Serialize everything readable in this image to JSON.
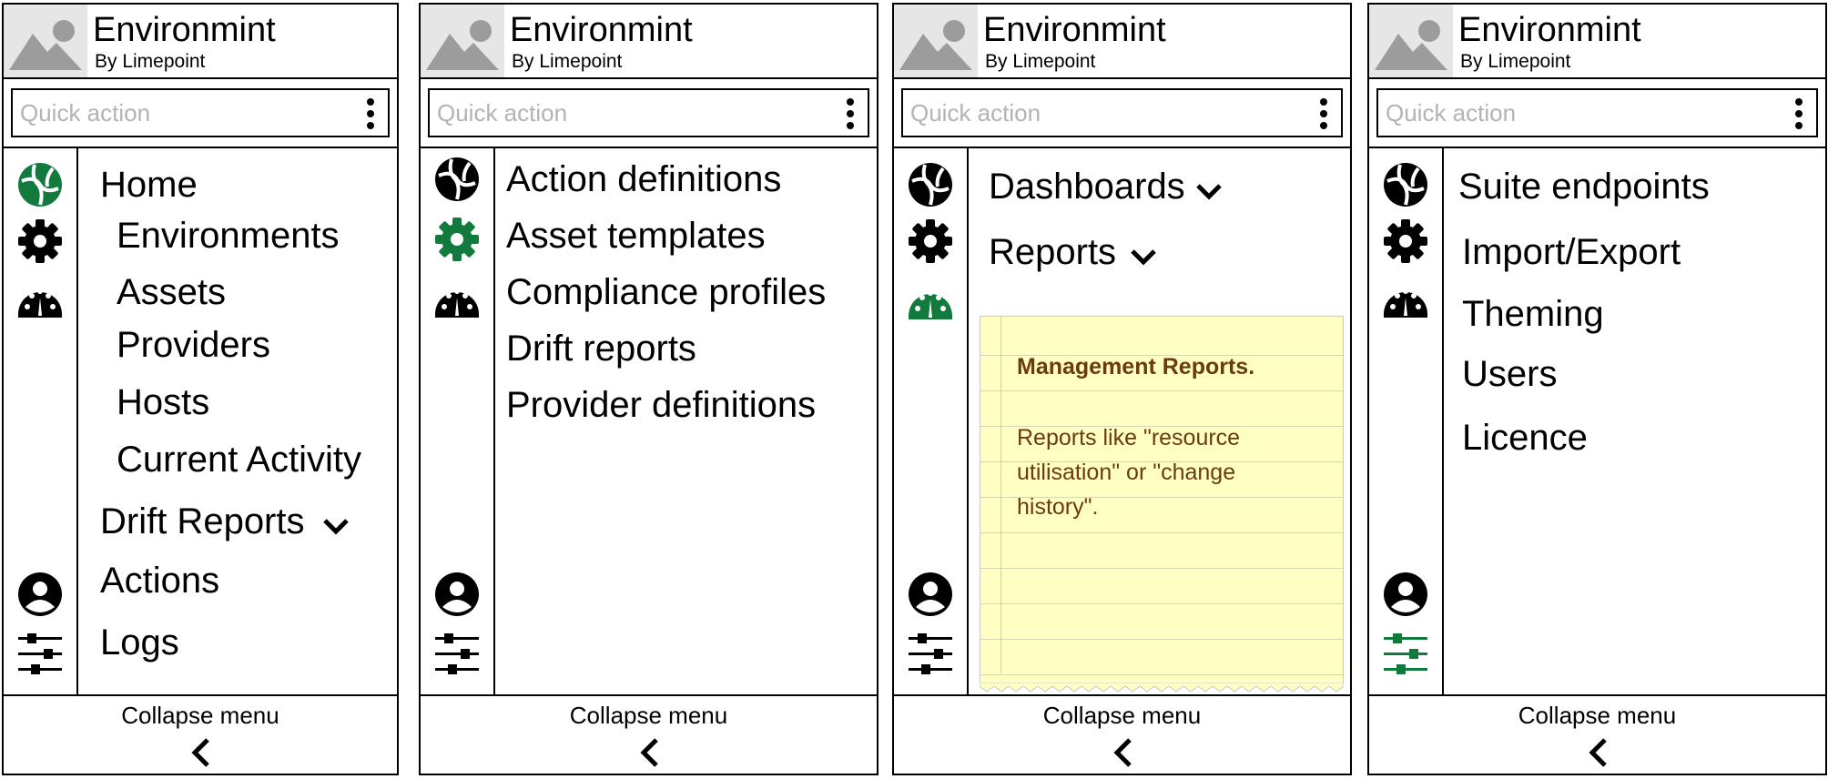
{
  "app": {
    "title": "Environmint",
    "subtitle": "By Limepoint"
  },
  "quick_action": {
    "placeholder": "Quick action"
  },
  "footer": {
    "label": "Collapse menu"
  },
  "colors": {
    "accent": "#117a3c",
    "note_bg": "#ffffc4",
    "note_text": "#6b3a10"
  },
  "rail_icons": [
    "globe-icon",
    "gear-icon",
    "dashboard-gauge-icon",
    "user-icon",
    "sliders-icon"
  ],
  "panels": [
    {
      "active_icon": "globe-icon",
      "items": [
        "Home",
        "Environments",
        "Assets",
        "Providers",
        "Hosts",
        "Current Activity",
        "Drift Reports",
        "Actions",
        "Logs"
      ]
    },
    {
      "active_icon": "gear-icon",
      "items": [
        "Action definitions",
        "Asset templates",
        "Compliance profiles",
        "Drift reports",
        "Provider definitions"
      ]
    },
    {
      "active_icon": "dashboard-gauge-icon",
      "items": [
        "Dashboards",
        "Reports"
      ],
      "note": {
        "title": "Management Reports.",
        "body": "Reports like \"resource utilisation\" or \"change history\"."
      }
    },
    {
      "active_icon": "sliders-icon",
      "items": [
        "Suite endpoints",
        "Import/Export",
        "Theming",
        "Users",
        "Licence"
      ]
    }
  ]
}
